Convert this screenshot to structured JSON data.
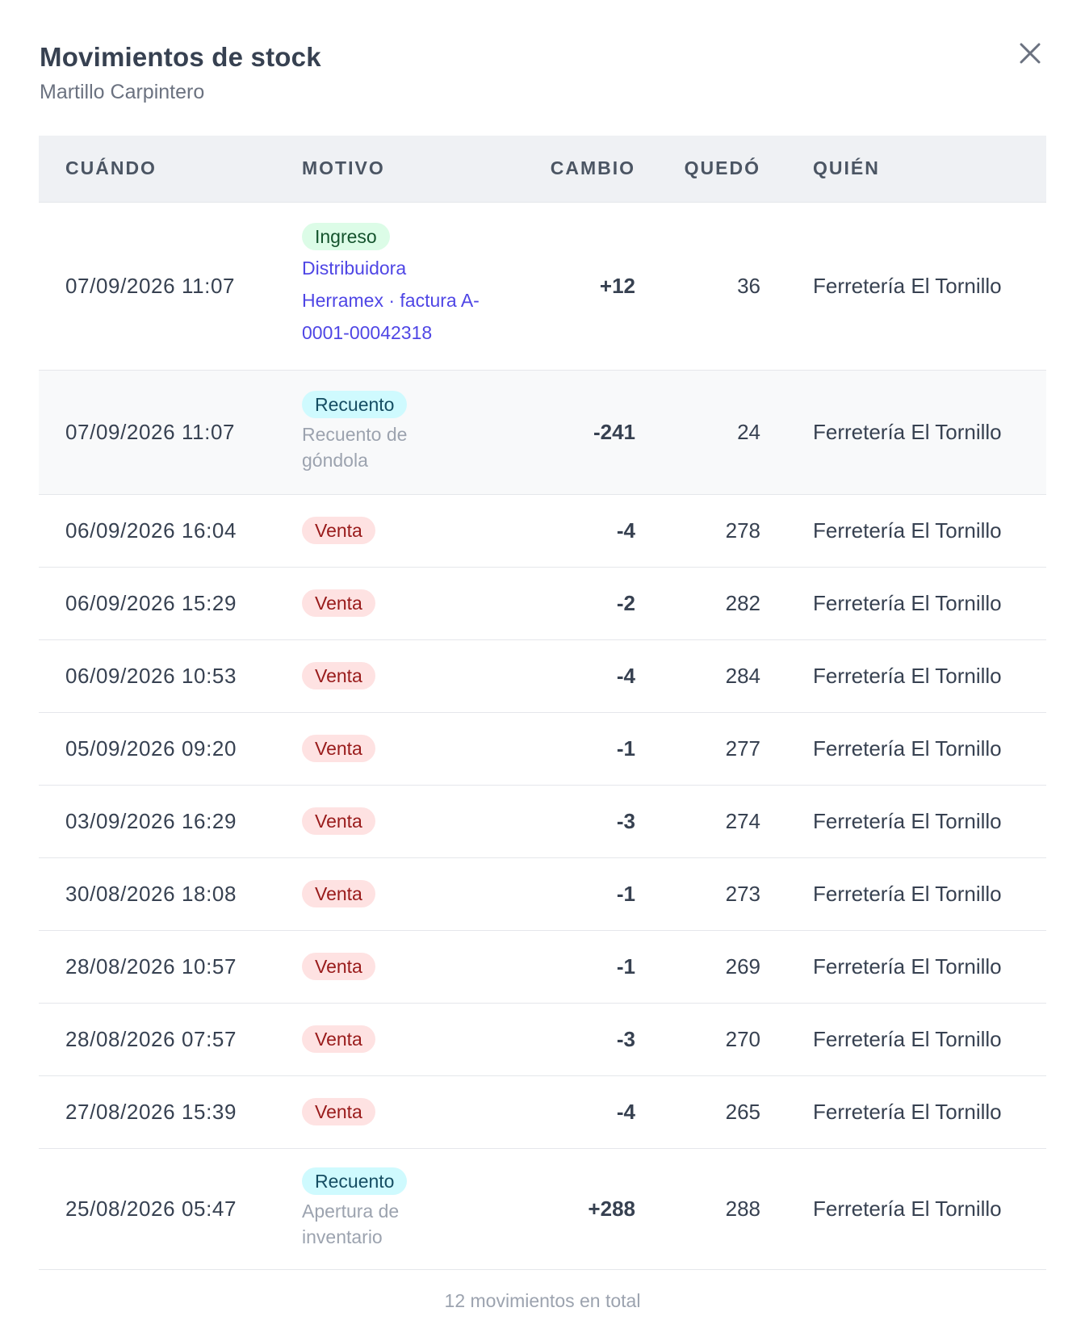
{
  "header": {
    "title": "Movimientos de stock",
    "subtitle": "Martillo Carpintero"
  },
  "columns": {
    "when": "CUÁNDO",
    "reason": "MOTIVO",
    "change": "CAMBIO",
    "left": "QUEDÓ",
    "who": "QUIÉN"
  },
  "rows": [
    {
      "when": "07/09/2026 11:07",
      "badge": "Ingreso",
      "badge_type": "ingreso",
      "note": "Distribuidora Herramex · factura A-0001-00042318",
      "note_link": true,
      "change": "+12",
      "left": "36",
      "who": "Ferretería El Tornillo"
    },
    {
      "when": "07/09/2026 11:07",
      "badge": "Recuento",
      "badge_type": "recuento",
      "note": "Recuento de góndola",
      "note_link": false,
      "change": "-241",
      "left": "24",
      "who": "Ferretería El Tornillo",
      "highlight": true
    },
    {
      "when": "06/09/2026 16:04",
      "badge": "Venta",
      "badge_type": "venta",
      "note": "",
      "change": "-4",
      "left": "278",
      "who": "Ferretería El Tornillo"
    },
    {
      "when": "06/09/2026 15:29",
      "badge": "Venta",
      "badge_type": "venta",
      "note": "",
      "change": "-2",
      "left": "282",
      "who": "Ferretería El Tornillo"
    },
    {
      "when": "06/09/2026 10:53",
      "badge": "Venta",
      "badge_type": "venta",
      "note": "",
      "change": "-4",
      "left": "284",
      "who": "Ferretería El Tornillo"
    },
    {
      "when": "05/09/2026 09:20",
      "badge": "Venta",
      "badge_type": "venta",
      "note": "",
      "change": "-1",
      "left": "277",
      "who": "Ferretería El Tornillo"
    },
    {
      "when": "03/09/2026 16:29",
      "badge": "Venta",
      "badge_type": "venta",
      "note": "",
      "change": "-3",
      "left": "274",
      "who": "Ferretería El Tornillo"
    },
    {
      "when": "30/08/2026 18:08",
      "badge": "Venta",
      "badge_type": "venta",
      "note": "",
      "change": "-1",
      "left": "273",
      "who": "Ferretería El Tornillo"
    },
    {
      "when": "28/08/2026 10:57",
      "badge": "Venta",
      "badge_type": "venta",
      "note": "",
      "change": "-1",
      "left": "269",
      "who": "Ferretería El Tornillo"
    },
    {
      "when": "28/08/2026 07:57",
      "badge": "Venta",
      "badge_type": "venta",
      "note": "",
      "change": "-3",
      "left": "270",
      "who": "Ferretería El Tornillo"
    },
    {
      "when": "27/08/2026 15:39",
      "badge": "Venta",
      "badge_type": "venta",
      "note": "",
      "change": "-4",
      "left": "265",
      "who": "Ferretería El Tornillo"
    },
    {
      "when": "25/08/2026 05:47",
      "badge": "Recuento",
      "badge_type": "recuento",
      "note": "Apertura de inventario",
      "note_link": false,
      "change": "+288",
      "left": "288",
      "who": "Ferretería El Tornillo"
    }
  ],
  "footer": "12 movimientos en total",
  "icons": {
    "close": "close-icon"
  },
  "colors": {
    "ingreso_bg": "#dcfce7",
    "recuento_bg": "#cffafe",
    "venta_bg": "#fee2e2",
    "link": "#4f46e5"
  }
}
